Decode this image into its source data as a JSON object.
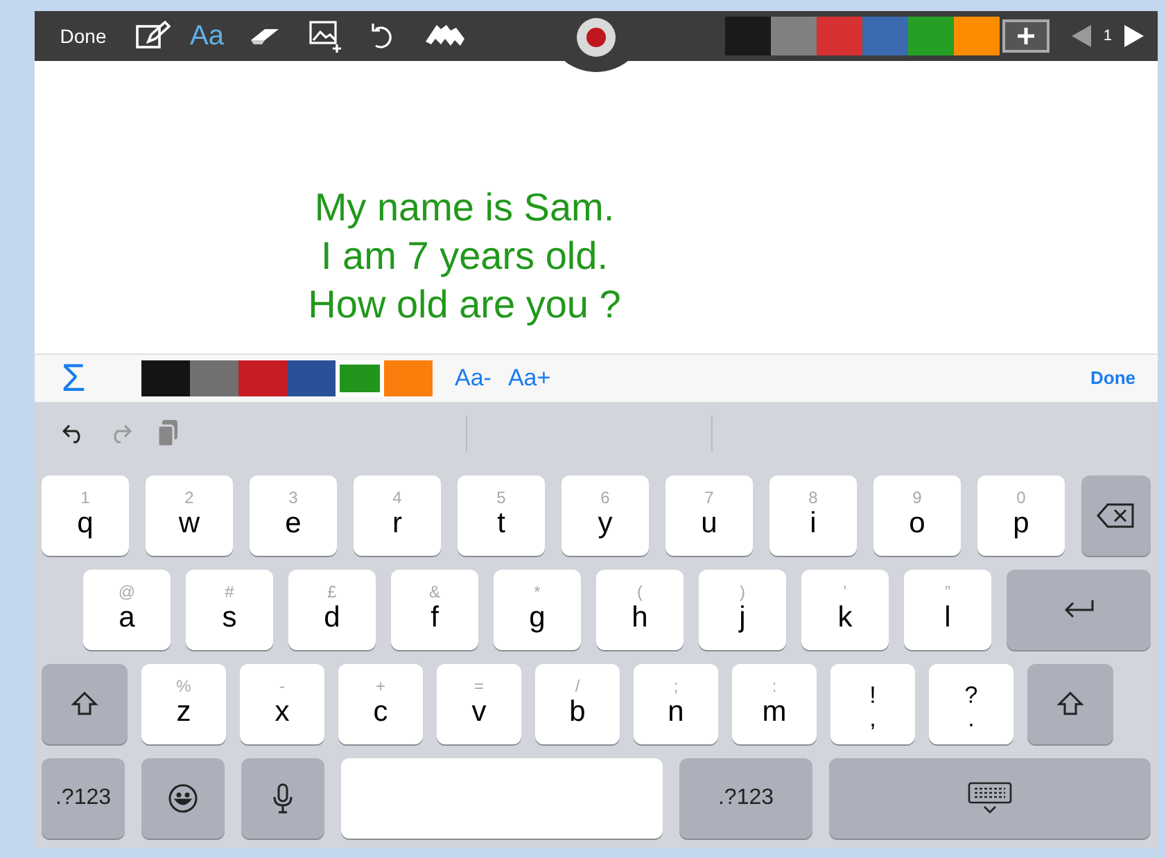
{
  "toolbar": {
    "done": "Done",
    "font_button": "Aa",
    "colors": [
      {
        "color": "#1a1a1a"
      },
      {
        "color": "#808080"
      },
      {
        "color": "#d63030"
      },
      {
        "color": "#3a6bb0"
      },
      {
        "color": "#25a025"
      },
      {
        "color": "#fb8c00"
      }
    ],
    "page": "1"
  },
  "document": {
    "lines": [
      "My name is Sam.",
      "I am 7 years old.",
      "How old are you ?"
    ]
  },
  "format_bar": {
    "sigma": "Σ",
    "colors": [
      {
        "color": "#141414",
        "selected": false
      },
      {
        "color": "#717171",
        "selected": false
      },
      {
        "color": "#c81c24",
        "selected": false
      },
      {
        "color": "#2a5198",
        "selected": false
      },
      {
        "color": "#23941c",
        "selected": true
      },
      {
        "color": "#fb7e0c",
        "selected": false
      }
    ],
    "decrease": "Aa-",
    "increase": "Aa+",
    "done": "Done"
  },
  "keyboard": {
    "rows": [
      [
        {
          "kind": "letter",
          "label": "q",
          "hint": "1"
        },
        {
          "kind": "letter",
          "label": "w",
          "hint": "2"
        },
        {
          "kind": "letter",
          "label": "e",
          "hint": "3"
        },
        {
          "kind": "letter",
          "label": "r",
          "hint": "4"
        },
        {
          "kind": "letter",
          "label": "t",
          "hint": "5"
        },
        {
          "kind": "letter",
          "label": "y",
          "hint": "6"
        },
        {
          "kind": "letter",
          "label": "u",
          "hint": "7"
        },
        {
          "kind": "letter",
          "label": "i",
          "hint": "8"
        },
        {
          "kind": "letter",
          "label": "o",
          "hint": "9"
        },
        {
          "kind": "letter",
          "label": "p",
          "hint": "0"
        },
        {
          "kind": "delete"
        }
      ],
      [
        {
          "kind": "letter",
          "label": "a",
          "hint": "@"
        },
        {
          "kind": "letter",
          "label": "s",
          "hint": "#"
        },
        {
          "kind": "letter",
          "label": "d",
          "hint": "£"
        },
        {
          "kind": "letter",
          "label": "f",
          "hint": "&"
        },
        {
          "kind": "letter",
          "label": "g",
          "hint": "*"
        },
        {
          "kind": "letter",
          "label": "h",
          "hint": "("
        },
        {
          "kind": "letter",
          "label": "j",
          "hint": ")"
        },
        {
          "kind": "letter",
          "label": "k",
          "hint": "’"
        },
        {
          "kind": "letter",
          "label": "l",
          "hint": "”"
        },
        {
          "kind": "return"
        }
      ],
      [
        {
          "kind": "shift"
        },
        {
          "kind": "letter",
          "label": "z",
          "hint": "%"
        },
        {
          "kind": "letter",
          "label": "x",
          "hint": "-"
        },
        {
          "kind": "letter",
          "label": "c",
          "hint": "+"
        },
        {
          "kind": "letter",
          "label": "v",
          "hint": "="
        },
        {
          "kind": "letter",
          "label": "b",
          "hint": "/"
        },
        {
          "kind": "letter",
          "label": "n",
          "hint": ";"
        },
        {
          "kind": "letter",
          "label": "m",
          "hint": ":"
        },
        {
          "kind": "punct",
          "label": ",",
          "hint": "!"
        },
        {
          "kind": "punct",
          "label": ".",
          "hint": "?"
        },
        {
          "kind": "shift"
        }
      ],
      [
        {
          "kind": "mode",
          "label": ".?123"
        },
        {
          "kind": "emoji"
        },
        {
          "kind": "mic"
        },
        {
          "kind": "space"
        },
        {
          "kind": "mode",
          "label": ".?123"
        },
        {
          "kind": "hide"
        }
      ]
    ]
  }
}
